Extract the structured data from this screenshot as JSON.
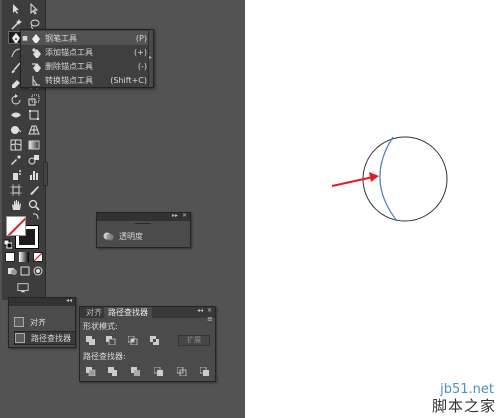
{
  "pen_flyout": {
    "items": [
      {
        "label": "钢笔工具",
        "shortcut": "(P)",
        "icon": "pen-icon",
        "selected": true
      },
      {
        "label": "添加锚点工具",
        "shortcut": "(+)",
        "icon": "add-anchor-icon",
        "selected": false
      },
      {
        "label": "删除锚点工具",
        "shortcut": "(-)",
        "icon": "delete-anchor-icon",
        "selected": false
      },
      {
        "label": "转换锚点工具",
        "shortcut": "(Shift+C)",
        "icon": "convert-anchor-icon",
        "selected": false
      }
    ]
  },
  "transparency_panel": {
    "label": "透明度",
    "icon": "transparency-icon"
  },
  "align_panel": {
    "items": [
      "对齐",
      "路径查找器"
    ]
  },
  "pathfinder_panel": {
    "tabs": [
      "对齐",
      "路径查找器"
    ],
    "shape_modes_label": "形状模式:",
    "pathfinders_label": "路径查找器:",
    "expand_label": "扩展"
  },
  "watermark": {
    "site": "jb51.net",
    "name": "脚本之家"
  },
  "colors": {
    "workspace": "#535353",
    "panel": "#4b4b4b",
    "arrow": "#e31c23",
    "path": "#4a7bc0",
    "circle": "#333333"
  }
}
